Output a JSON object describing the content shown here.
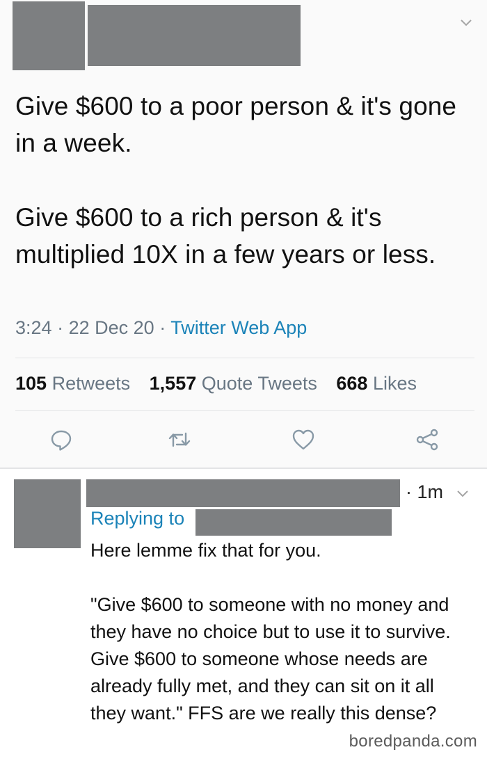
{
  "tweet": {
    "paragraphs": [
      "Give $600 to a poor person & it's gone in a week.",
      "Give $600 to a rich person & it's multiplied 10X in a few years or less."
    ],
    "time": "3:24",
    "sep": "·",
    "date": "22 Dec 20",
    "app": "Twitter Web App",
    "retweets_count": "105",
    "retweets_label": "Retweets",
    "quotes_count": "1,557",
    "quotes_label": "Quote Tweets",
    "likes_count": "668",
    "likes_label": "Likes"
  },
  "reply": {
    "time": "· 1m",
    "replying_to": "Replying to",
    "paragraphs": [
      "Here lemme fix that for you.",
      "\"Give $600 to someone with no money and they have no choice but to use it to survive. Give $600 to someone whose needs are already fully met, and they can sit on it all they want.\" FFS are we really this dense?"
    ]
  },
  "icons": {
    "chevron": "chevron-down-icon",
    "reply": "reply-icon",
    "retweet": "retweet-icon",
    "like": "heart-icon",
    "share": "share-icon"
  },
  "colors": {
    "link": "#1b83b8",
    "muted": "#687683",
    "redaction": "#7d7f81",
    "icon": "#8899a6"
  },
  "watermark": "boredpanda.com"
}
